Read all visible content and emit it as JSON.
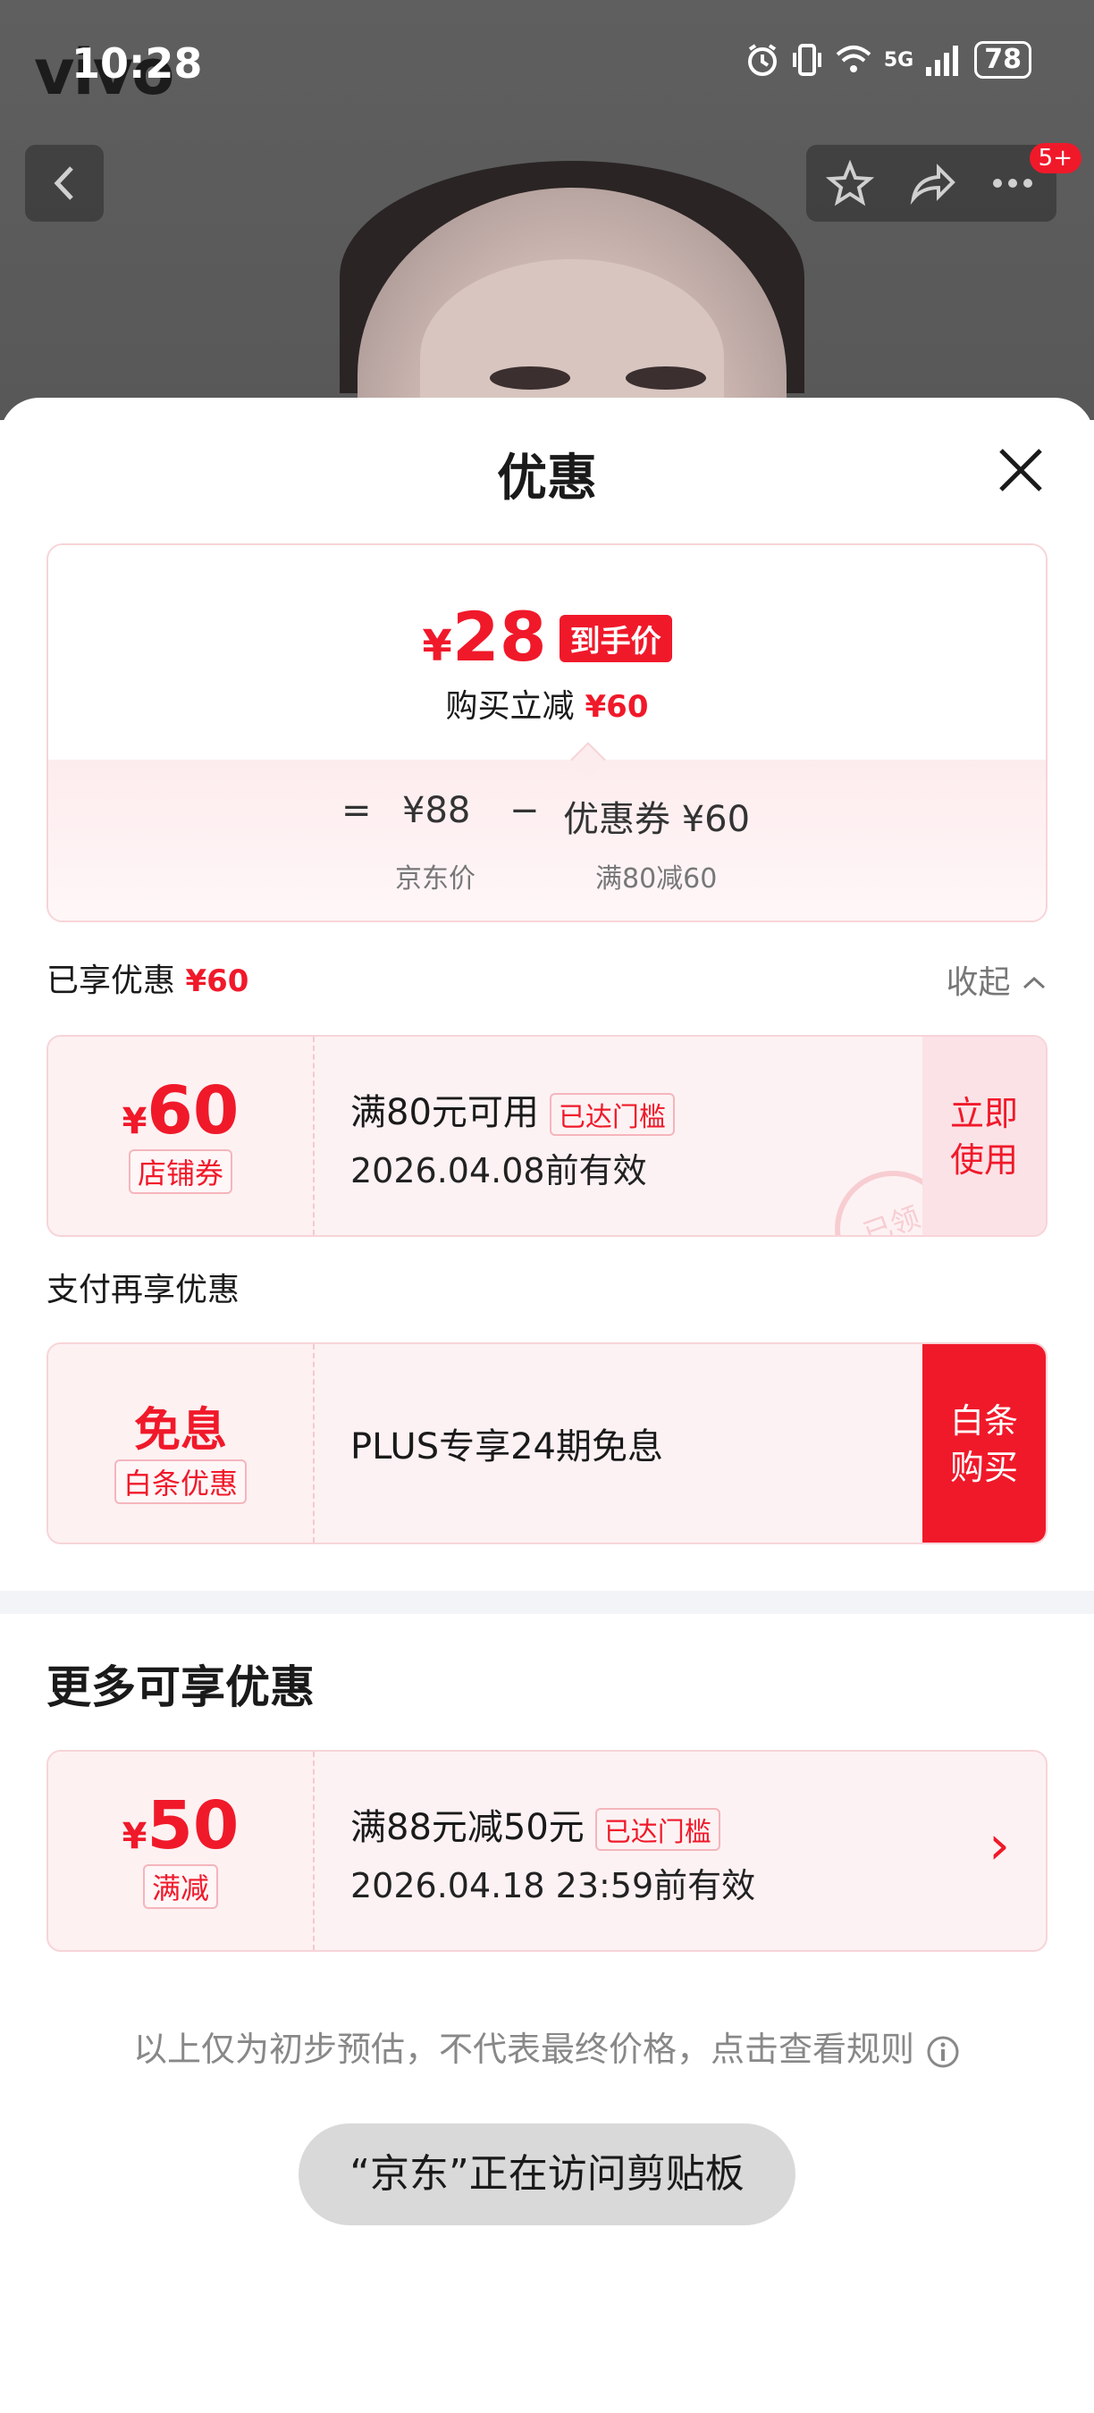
{
  "status_bar": {
    "carrier_logo": "vivo",
    "time": "10:28",
    "battery": "78",
    "network": "5G"
  },
  "nav": {
    "badge": "5+"
  },
  "sheet": {
    "title": "优惠"
  },
  "summary": {
    "currency": "¥",
    "final_price": "28",
    "final_tag": "到手价",
    "discount_label": "购买立减",
    "discount_value": "¥60",
    "eq_sign": "=",
    "base_price": "¥88",
    "minus_sign": "−",
    "coupon_text": "优惠券 ¥60",
    "base_label": "京东价",
    "coupon_rule": "满80减60"
  },
  "enjoyed": {
    "label": "已享优惠",
    "value": "¥60",
    "collapse": "收起"
  },
  "coupon_store": {
    "currency": "¥",
    "amount": "60",
    "type": "店铺券",
    "condition": "满80元可用",
    "status": "已达门槛",
    "validity": "2026.04.08前有效",
    "action": "立即使用",
    "stamp": "已领"
  },
  "pay_section": {
    "label": "支付再享优惠"
  },
  "coupon_baitiao": {
    "amount": "免息",
    "type": "白条优惠",
    "text": "PLUS专享24期免息",
    "action": "白条购买"
  },
  "more": {
    "title": "更多可享优惠"
  },
  "coupon_more": {
    "currency": "¥",
    "amount": "50",
    "type": "满减",
    "condition": "满88元减50元",
    "status": "已达门槛",
    "validity": "2026.04.18 23:59前有效",
    "chevron": "›"
  },
  "disclaimer": "以上仅为初步预估，不代表最终价格，点击查看规则",
  "toast": "“京东”正在访问剪贴板",
  "colors": {
    "accent": "#f0192a",
    "coupon_bg": "#fdf2f3",
    "border": "#f7d4d8"
  }
}
